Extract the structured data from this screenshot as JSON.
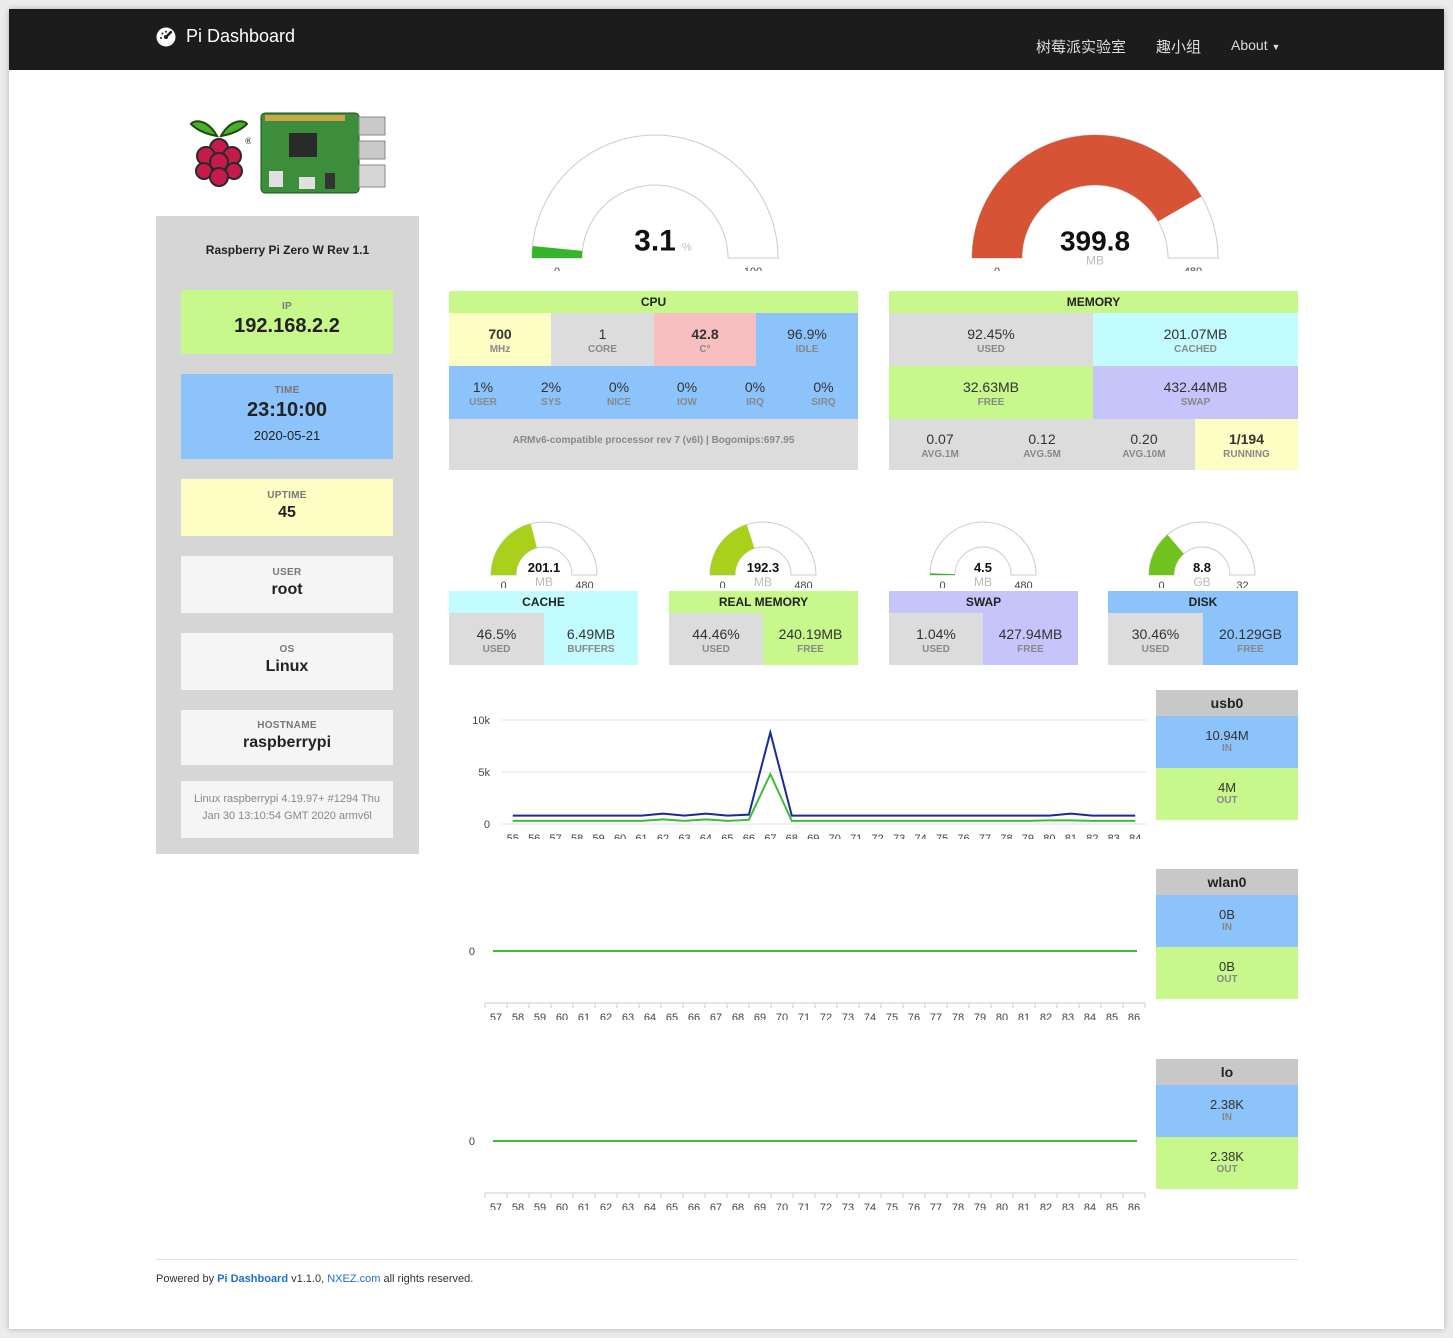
{
  "nav": {
    "brand": "Pi Dashboard",
    "links": [
      "树莓派实验室",
      "趣小组",
      "About"
    ]
  },
  "model": "Raspberry Pi Zero W Rev 1.1",
  "ip": {
    "label": "IP",
    "value": "192.168.2.2"
  },
  "time": {
    "label": "TIME",
    "value": "23:10:00",
    "date": "2020-05-21"
  },
  "uptime": {
    "label": "UPTIME",
    "value": "45"
  },
  "user": {
    "label": "USER",
    "value": "root"
  },
  "os": {
    "label": "OS",
    "value": "Linux"
  },
  "hostname": {
    "label": "HOSTNAME",
    "value": "raspberrypi"
  },
  "kernel": "Linux raspberrypi 4.19.97+ #1294 Thu Jan 30 13:10:54 GMT 2020 armv6l",
  "cpu_gauge": {
    "value": "3.1",
    "unit": "%",
    "min": "0",
    "max": "100",
    "fraction": 0.031
  },
  "mem_gauge": {
    "value": "399.8",
    "unit": "MB",
    "min": "0",
    "max": "480",
    "fraction": 0.833
  },
  "cpu": {
    "title": "CPU",
    "top": [
      {
        "v": "700",
        "k": "MHz"
      },
      {
        "v": "1",
        "k": "CORE"
      },
      {
        "v": "42.8",
        "k": "C°"
      },
      {
        "v": "96.9%",
        "k": "IDLE"
      }
    ],
    "mid": [
      {
        "v": "1%",
        "k": "USER"
      },
      {
        "v": "2%",
        "k": "SYS"
      },
      {
        "v": "0%",
        "k": "NICE"
      },
      {
        "v": "0%",
        "k": "IOW"
      },
      {
        "v": "0%",
        "k": "IRQ"
      },
      {
        "v": "0%",
        "k": "SIRQ"
      }
    ],
    "info": "ARMv6-compatible processor rev 7 (v6l) | Bogomips:697.95"
  },
  "memory": {
    "title": "MEMORY",
    "cells": [
      {
        "v": "92.45%",
        "k": "USED"
      },
      {
        "v": "201.07MB",
        "k": "CACHED"
      },
      {
        "v": "32.63MB",
        "k": "FREE"
      },
      {
        "v": "432.44MB",
        "k": "SWAP"
      }
    ],
    "load": [
      {
        "v": "0.07",
        "k": "AVG.1M"
      },
      {
        "v": "0.12",
        "k": "AVG.5M"
      },
      {
        "v": "0.20",
        "k": "AVG.10M"
      },
      {
        "v": "1/194",
        "k": "RUNNING"
      }
    ]
  },
  "small": [
    {
      "title": "CACHE",
      "value": "201.1",
      "unit": "MB",
      "min": "0",
      "max": "480",
      "fraction": 0.419,
      "color": "#a9d01a",
      "a": {
        "v": "46.5%",
        "k": "USED"
      },
      "b": {
        "v": "6.49MB",
        "k": "BUFFERS"
      }
    },
    {
      "title": "REAL MEMORY",
      "value": "192.3",
      "unit": "MB",
      "min": "0",
      "max": "480",
      "fraction": 0.401,
      "color": "#a9d01a",
      "a": {
        "v": "44.46%",
        "k": "USED"
      },
      "b": {
        "v": "240.19MB",
        "k": "FREE"
      }
    },
    {
      "title": "SWAP",
      "value": "4.5",
      "unit": "MB",
      "min": "0",
      "max": "480",
      "fraction": 0.0094,
      "color": "#35b52a",
      "a": {
        "v": "1.04%",
        "k": "USED"
      },
      "b": {
        "v": "427.94MB",
        "k": "FREE"
      }
    },
    {
      "title": "DISK",
      "value": "8.8",
      "unit": "GB",
      "min": "0",
      "max": "32",
      "fraction": 0.275,
      "color": "#70c31c",
      "a": {
        "v": "30.46%",
        "k": "USED"
      },
      "b": {
        "v": "20.129GB",
        "k": "FREE"
      }
    }
  ],
  "net": [
    {
      "name": "usb0",
      "in": "10.94M",
      "out": "4M",
      "in_label": "IN",
      "out_label": "OUT"
    },
    {
      "name": "wlan0",
      "in": "0B",
      "out": "0B",
      "in_label": "IN",
      "out_label": "OUT"
    },
    {
      "name": "lo",
      "in": "2.38K",
      "out": "2.38K",
      "in_label": "IN",
      "out_label": "OUT"
    }
  ],
  "chart_data": [
    {
      "type": "line",
      "x": [
        55,
        56,
        57,
        58,
        59,
        60,
        61,
        62,
        63,
        64,
        65,
        66,
        67,
        68,
        69,
        70,
        71,
        72,
        73,
        74,
        75,
        76,
        77,
        78,
        79,
        80,
        81,
        82,
        83,
        84
      ],
      "yticks": [
        "10k",
        "5k",
        "0"
      ],
      "ylim": [
        0,
        10000
      ],
      "series": [
        {
          "values": [
            800,
            800,
            800,
            800,
            800,
            800,
            800,
            1000,
            800,
            1000,
            800,
            900,
            8800,
            800,
            800,
            800,
            800,
            800,
            800,
            800,
            800,
            800,
            800,
            800,
            800,
            800,
            1000,
            800,
            800,
            800
          ],
          "color": "#1b2a9a"
        },
        {
          "values": [
            300,
            300,
            300,
            300,
            300,
            300,
            300,
            450,
            300,
            450,
            300,
            400,
            4800,
            300,
            300,
            300,
            300,
            300,
            300,
            300,
            300,
            300,
            300,
            300,
            300,
            350,
            350,
            300,
            300,
            300
          ],
          "color": "#3fbb3a"
        }
      ]
    },
    {
      "type": "line",
      "x": [
        57,
        58,
        59,
        60,
        61,
        62,
        63,
        64,
        65,
        66,
        67,
        68,
        69,
        70,
        71,
        72,
        73,
        74,
        75,
        76,
        77,
        78,
        79,
        80,
        81,
        82,
        83,
        84,
        85,
        86
      ],
      "yticks": [
        "0"
      ],
      "series": [
        {
          "values": [
            0,
            0,
            0,
            0,
            0,
            0,
            0,
            0,
            0,
            0,
            0,
            0,
            0,
            0,
            0,
            0,
            0,
            0,
            0,
            0,
            0,
            0,
            0,
            0,
            0,
            0,
            0,
            0,
            0,
            0
          ],
          "color": "#3fbb3a"
        }
      ]
    },
    {
      "type": "line",
      "x": [
        57,
        58,
        59,
        60,
        61,
        62,
        63,
        64,
        65,
        66,
        67,
        68,
        69,
        70,
        71,
        72,
        73,
        74,
        75,
        76,
        77,
        78,
        79,
        80,
        81,
        82,
        83,
        84,
        85,
        86
      ],
      "yticks": [
        "0"
      ],
      "series": [
        {
          "values": [
            0,
            0,
            0,
            0,
            0,
            0,
            0,
            0,
            0,
            0,
            0,
            0,
            0,
            0,
            0,
            0,
            0,
            0,
            0,
            0,
            0,
            0,
            0,
            0,
            0,
            0,
            0,
            0,
            0,
            0
          ],
          "color": "#3fbb3a"
        }
      ]
    }
  ],
  "footer": {
    "prefix": "Powered by",
    "brand": "Pi Dashboard",
    "version": "v1.1.0,",
    "site": "NXEZ.com",
    "suffix": "all rights reserved."
  },
  "colors": {
    "navbar": "#1c1c1c",
    "cpu_gauge": "#35b52a",
    "mem_gauge": "#d65336"
  }
}
